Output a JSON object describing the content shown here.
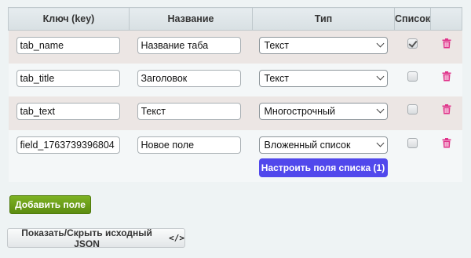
{
  "table": {
    "headers": {
      "key": "Ключ (key)",
      "name": "Название",
      "type": "Тип",
      "list": "Список",
      "actions": ""
    },
    "rows": [
      {
        "key": "tab_name",
        "name": "Название таба",
        "type": "Текст",
        "list_checked": true
      },
      {
        "key": "tab_title",
        "name": "Заголовок",
        "type": "Текст",
        "list_checked": false
      },
      {
        "key": "tab_text",
        "name": "Текст",
        "type": "Многострочный",
        "list_checked": false
      },
      {
        "key": "field_1763739396804",
        "name": "Новое поле",
        "type": "Вложенный список",
        "list_checked": false
      }
    ],
    "config_button": "Настроить поля списка (1)"
  },
  "buttons": {
    "add_field": "Добавить поле",
    "toggle_json": "Показать/Скрыть исходный JSON",
    "toggle_json_icon": "</>"
  },
  "icons": {
    "delete": "trash-icon",
    "dropdown": "chevron-down-icon",
    "code": "code-icon"
  },
  "colors": {
    "config_button": "#5148ec",
    "add_button": "#6aa01a",
    "trash": "#e0338a",
    "row_alt": "#ece6e4"
  }
}
